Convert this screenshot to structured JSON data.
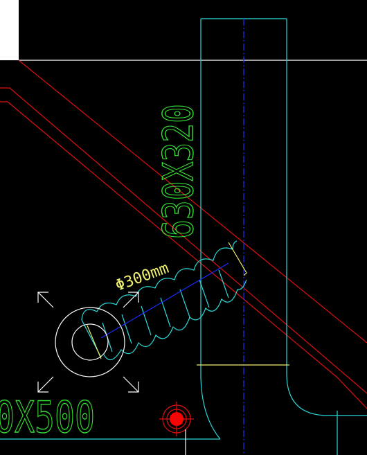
{
  "drawing": {
    "background": "#000000",
    "colors": {
      "cyan": "#2ad8d8",
      "red": "#e01010",
      "blue": "#1a2cff",
      "white": "#ffffff",
      "yellow": "#f0f070",
      "green": "#33dd33",
      "marker": "#ff0000"
    },
    "labels": {
      "duct_size": "630X320",
      "duct_size_partial": "0X500",
      "flex_duct_diameter": "Φ300mm"
    },
    "icons": {
      "marker": "target-marker-icon",
      "selection": "selection-corner-icon"
    }
  }
}
